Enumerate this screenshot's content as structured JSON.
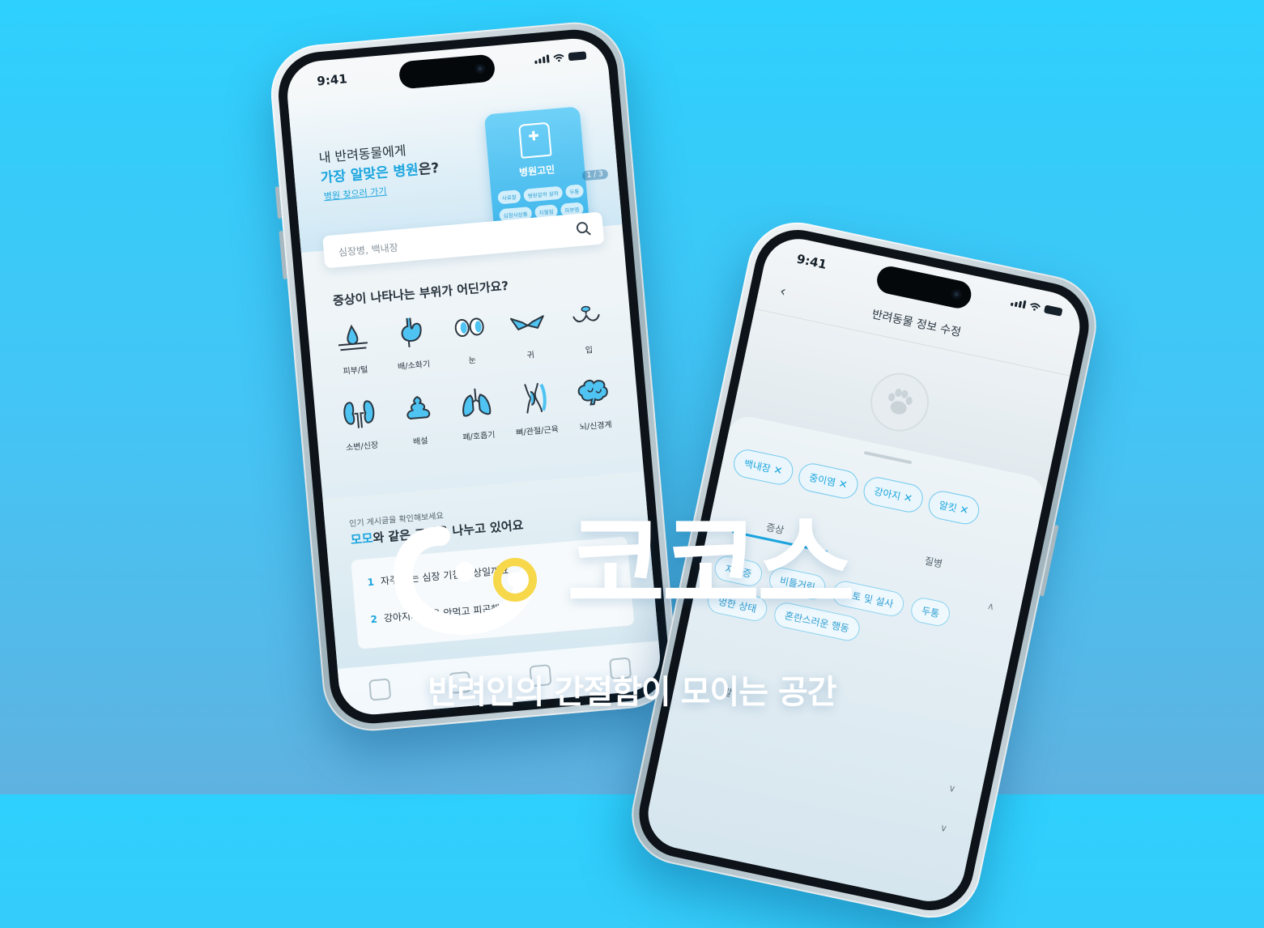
{
  "phone_home": {
    "status_time": "9:41",
    "hero": {
      "line1": "내 반려동물에게",
      "line2_accent": "가장 알맞은 병원",
      "line2_rest": "은?",
      "link": "병원 찾으러 가기",
      "card_title": "병원고민",
      "card_chips_row1": [
        "사료잘",
        "병원갈까 살까",
        "두통"
      ],
      "card_chips_row2": [
        "심장사상충",
        "치열점",
        "피부염"
      ],
      "pager": "1 / 3"
    },
    "search": {
      "placeholder": "심장병, 백내장"
    },
    "categories_title": "증상이 나타나는 부위가 어딘가요?",
    "categories": [
      {
        "label": "피부/털",
        "icon": "skin-icon"
      },
      {
        "label": "배/소화기",
        "icon": "stomach-icon"
      },
      {
        "label": "눈",
        "icon": "eye-icon"
      },
      {
        "label": "귀",
        "icon": "ear-icon"
      },
      {
        "label": "입",
        "icon": "mouth-icon"
      },
      {
        "label": "소변/신장",
        "icon": "kidney-icon"
      },
      {
        "label": "배설",
        "icon": "poop-icon"
      },
      {
        "label": "폐/호흡기",
        "icon": "lungs-icon"
      },
      {
        "label": "뼈/관절/근육",
        "icon": "bone-icon"
      },
      {
        "label": "뇌/신경계",
        "icon": "brain-icon"
      }
    ],
    "popular": {
      "subtitle": "인기 게시글을 확인해보세요",
      "title_accent": "모모",
      "title_rest": "와 같은 고민을 나누고 있어요",
      "posts": [
        {
          "num": "1",
          "text": "자주 하는 심장 기침 정상일까요"
        },
        {
          "num": "2",
          "text": "강아지가 밥을 안먹고 피곤해해요"
        }
      ]
    }
  },
  "phone_edit": {
    "status_time": "9:41",
    "title": "반려동물 정보 수정",
    "selected_tags": [
      "백내장",
      "중이염",
      "강아지",
      "알킷"
    ],
    "tabs": [
      "증상",
      "질병"
    ],
    "symptom_chips": [
      "지럼증",
      "비틀거림",
      "구토 및 설사",
      "두통",
      "멍한 상태",
      "혼란스러운 행동"
    ],
    "extra_label": "발"
  },
  "brand": {
    "logo_text": "코코스",
    "tagline": "반려인의 간절함이 모이는 공간"
  },
  "colors": {
    "accent": "#1ba5df",
    "background": "#2ed0fd",
    "logo_ring": "#ffffff",
    "logo_dot": "#f6d84a"
  }
}
